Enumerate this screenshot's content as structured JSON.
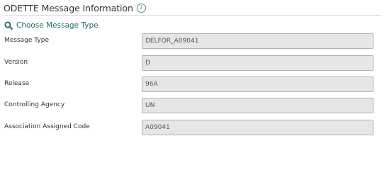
{
  "header": {
    "title": "ODETTE Message Information",
    "info_icon": "info-icon"
  },
  "choose_link": {
    "label": "Choose Message Type",
    "icon": "search-icon"
  },
  "fields": [
    {
      "label": "Message Type",
      "value": "DELFOR_A09041"
    },
    {
      "label": "Version",
      "value": "D"
    },
    {
      "label": "Release",
      "value": "96A"
    },
    {
      "label": "Controlling Agency",
      "value": "UN"
    },
    {
      "label": "Association Assigned Code",
      "value": "A09041"
    }
  ],
  "colors": {
    "link": "#1f6f6a",
    "input_bg": "#e6e6e6",
    "input_border": "#b3b3b3"
  }
}
